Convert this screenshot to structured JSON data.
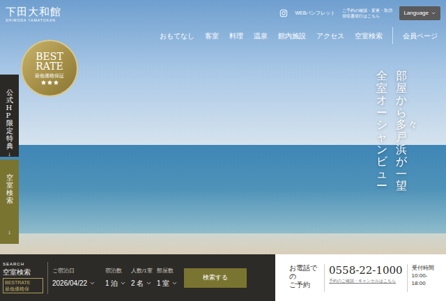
{
  "logo": {
    "name": "下田大和館",
    "romaji": "SHIMODA YAMATOKAN"
  },
  "header_links": {
    "pamphlet": "WEBパンフレット",
    "reservation": [
      "ご予約の確認・変更・取消",
      "領収書発行はこちら"
    ],
    "language": "Language"
  },
  "nav": [
    {
      "label": "おもてなし"
    },
    {
      "label": "客室"
    },
    {
      "label": "料理"
    },
    {
      "label": "温泉"
    },
    {
      "label": "館内施設"
    },
    {
      "label": "アクセス"
    },
    {
      "label": "空室検索"
    }
  ],
  "member_link": "会員ページ",
  "hero": {
    "catch": [
      "部屋から多々戸浜が一望",
      "全室オーシャンビュー"
    ]
  },
  "badge": {
    "title": [
      "BEST",
      "RATE"
    ],
    "subtitle": "最低価格保証",
    "stars": 3
  },
  "side_tabs": [
    {
      "label": "公式HP限定特典",
      "arrow": "↓",
      "color": "#2b2925"
    },
    {
      "label": "空室検索",
      "arrow": "↓",
      "color": "#7a7431"
    }
  ],
  "search": {
    "eyebrow": "SEARCH",
    "title": "空室検索",
    "badge": [
      "BESTRATE",
      "最低価格保"
    ],
    "fields": [
      {
        "label": "ご宿泊日",
        "value": "2026/04/22"
      },
      {
        "label": "宿泊数",
        "value": "1 泊"
      },
      {
        "label": "人数/1室",
        "value": "2 名"
      },
      {
        "label": "部屋数",
        "value": "1 室"
      }
    ],
    "button": "検索する"
  },
  "phone": {
    "label": [
      "お電話で",
      "の",
      "ご予約"
    ],
    "number": "0558-22-1000",
    "note": "予約のご確認・キャンセルはこちら",
    "hours_label": "受付時間",
    "hours": [
      "10:00-",
      "18:00"
    ]
  }
}
